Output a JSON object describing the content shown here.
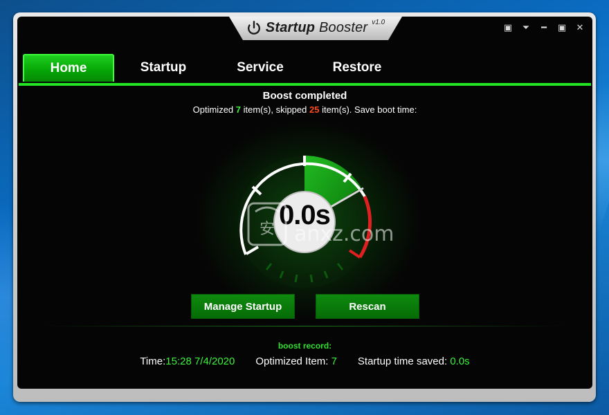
{
  "app": {
    "title_bold": "Startup",
    "title_light": "Booster",
    "version": "v1.0"
  },
  "window_controls": [
    {
      "name": "save-icon",
      "glyph": "▣"
    },
    {
      "name": "menu-dropdown-icon",
      "glyph": "⏷"
    },
    {
      "name": "minimize-icon",
      "glyph": "━"
    },
    {
      "name": "maximize-icon",
      "glyph": "▣"
    },
    {
      "name": "close-icon",
      "glyph": "✕"
    }
  ],
  "tabs": [
    {
      "label": "Home",
      "active": true
    },
    {
      "label": "Startup"
    },
    {
      "label": "Service"
    },
    {
      "label": "Restore"
    }
  ],
  "status": {
    "title": "Boost completed",
    "optimized_prefix": "Optimized ",
    "optimized_count": "7",
    "optimized_suffix": " item(s), skipped ",
    "skipped_count": "25",
    "skipped_suffix": " item(s). Save boot time:"
  },
  "gauge": {
    "value_text": "0.0s"
  },
  "buttons": {
    "manage": "Manage Startup",
    "rescan": "Rescan"
  },
  "record": {
    "title": "boost record:",
    "time_label": "Time:",
    "time_value": "15:28 7/4/2020",
    "optimized_label": "Optimized Item: ",
    "optimized_value": "7",
    "saved_label": "Startup time saved: ",
    "saved_value": "0.0s"
  },
  "watermark": {
    "text": "anxz.com",
    "badge": "安"
  },
  "colors": {
    "accent_green": "#22e622",
    "value_green": "#3df23d",
    "skipped_red": "#ff4a1c",
    "background": "#050505"
  }
}
